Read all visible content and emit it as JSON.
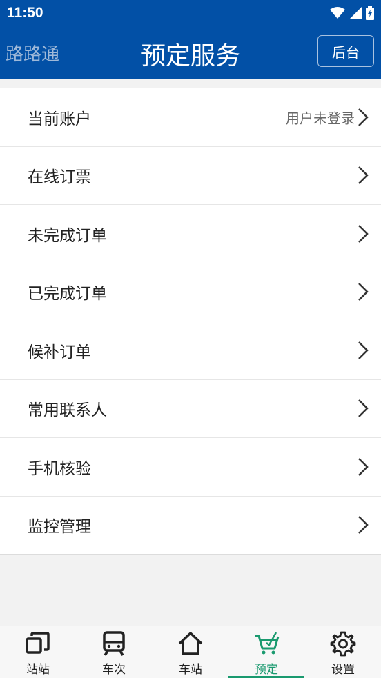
{
  "status_bar": {
    "time": "11:50"
  },
  "app_bar": {
    "brand": "路路通",
    "title": "预定服务",
    "admin_button": "后台"
  },
  "menu": {
    "items": [
      {
        "label": "当前账户",
        "value": "用户未登录"
      },
      {
        "label": "在线订票"
      },
      {
        "label": "未完成订单"
      },
      {
        "label": "已完成订单"
      },
      {
        "label": "候补订单"
      },
      {
        "label": "常用联系人"
      },
      {
        "label": "手机核验"
      },
      {
        "label": "监控管理"
      }
    ]
  },
  "bottom_nav": {
    "items": [
      {
        "label": "站站",
        "icon": "station-to-station-icon"
      },
      {
        "label": "车次",
        "icon": "train-icon"
      },
      {
        "label": "车站",
        "icon": "home-icon"
      },
      {
        "label": "预定",
        "icon": "cart-icon",
        "active": true
      },
      {
        "label": "设置",
        "icon": "gear-icon"
      }
    ]
  },
  "colors": {
    "header": "#0250a6",
    "accent": "#1a9a6f"
  }
}
